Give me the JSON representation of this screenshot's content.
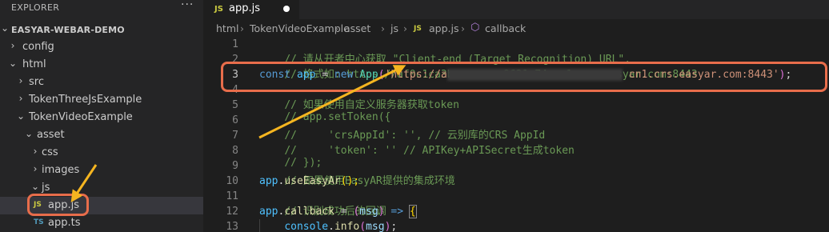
{
  "sidebar": {
    "title": "EXPLORER",
    "more": "···",
    "items": [
      {
        "label": "EASYAR-WEBAR-DEMO"
      },
      {
        "label": "config"
      },
      {
        "label": "html"
      },
      {
        "label": "src"
      },
      {
        "label": "TokenThreeJsExample"
      },
      {
        "label": "TokenVideoExample"
      },
      {
        "label": "asset"
      },
      {
        "label": "css"
      },
      {
        "label": "images"
      },
      {
        "label": "js"
      },
      {
        "label": "app.js",
        "icon": "JS"
      },
      {
        "label": "app.ts",
        "icon": "TS"
      }
    ]
  },
  "tabs": [
    {
      "label": "app.js",
      "icon": "JS",
      "dirty": true
    }
  ],
  "breadcrumb": [
    "html",
    "TokenVideoExample",
    "asset",
    "js",
    "app.js",
    "callback"
  ],
  "breadcrumb_icons": {
    "file": "JS",
    "symbol": "cube-icon"
  },
  "code": {
    "line_numbers": [
      "1",
      "2",
      "3",
      "4",
      "5",
      "6",
      "7",
      "8",
      "9",
      "10",
      "11",
      "12",
      "13"
    ],
    "l1": "// 请从开者中心获取 \"Client-end (Target Recognition) URL\",",
    "l2": "// 格式如: https://af0c1ca3b........9621c74.cn1.crs.easyar.com:8443",
    "l3_kw": "const",
    "l3_var": "app",
    "l3_op": " = ",
    "l3_new": "new",
    "l3_class": "App",
    "l3_str_a": "'https://a",
    "l3_str_b": "cn1.crs.easyar.com:8443'",
    "l3_end": ");",
    "l4": "// 如果使用自定义服务器获取token",
    "l5": "// app.setToken({",
    "l6": "//     'crsAppId': '', // 云别库的CRS AppId",
    "l7": "//     'token': '' // APIKey+APISecret生成token",
    "l8": "// });",
    "l9": "// 如果使用EasyAR提供的集成环境",
    "l10_obj": "app",
    "l10_fn": "useEasyAr",
    "l10_end": "();",
    "l11": "// 识别成功后的回调",
    "l12_obj": "app",
    "l12_prop": "callback",
    "l12_eq": " = ",
    "l12_param": "msg",
    "l12_arrow": "=>",
    "l13_obj": "console",
    "l13_fn": "info",
    "l13_arg": "msg"
  },
  "colors": {
    "annotation": "#e86d4b",
    "arrow": "#f5b520"
  }
}
